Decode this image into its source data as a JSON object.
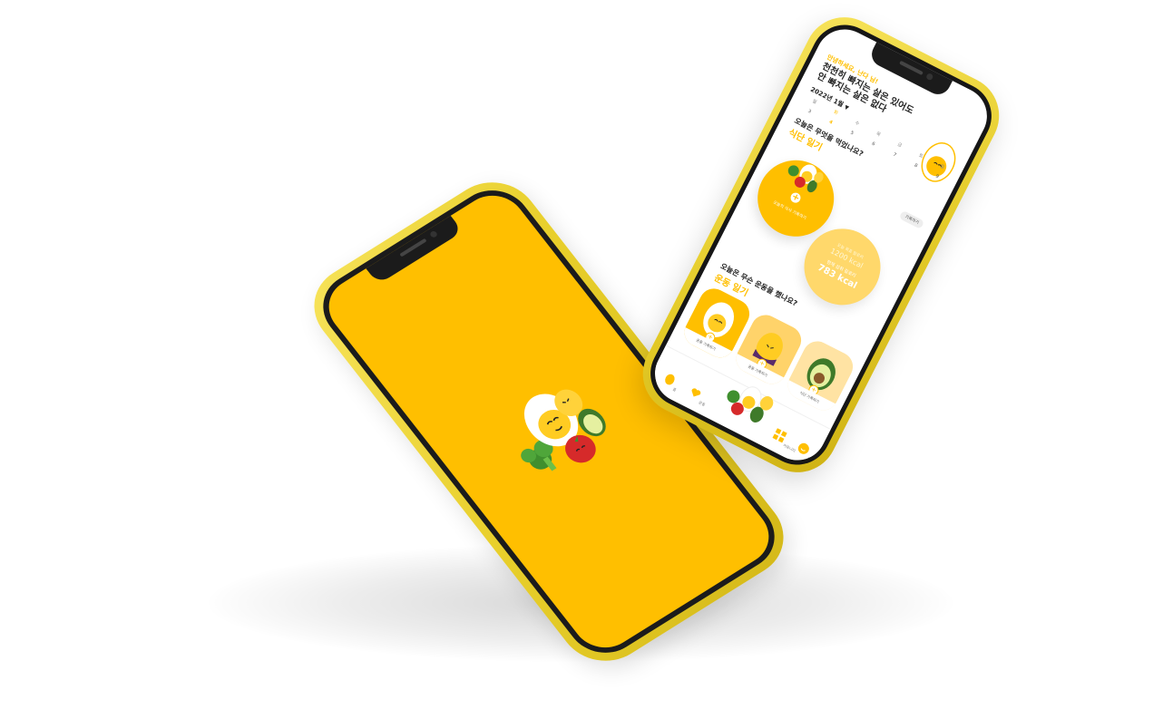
{
  "colors": {
    "accent": "#ffbf00",
    "frame": "#efd73a",
    "light": "#ffd86b"
  },
  "app": {
    "greeting": "안녕하세요, 난다 님!",
    "headline_1": "천천히 빠지는 살은 있어도",
    "headline_2": "안 빠지는 살은 없다",
    "month": "2022년 1월",
    "week": [
      {
        "w": "월",
        "n": "3"
      },
      {
        "w": "화",
        "n": "4"
      },
      {
        "w": "수",
        "n": "5"
      },
      {
        "w": "목",
        "n": "6"
      },
      {
        "w": "금",
        "n": "7"
      },
      {
        "w": "토",
        "n": "8"
      },
      {
        "w": "일",
        "n": "9"
      }
    ],
    "meal_question": "오늘은 무엇을 먹었나요?",
    "meal_title": "식단 일기",
    "record_button": "기록하기",
    "meal_circle_label": "오늘의 식사 기록하기",
    "target_label": "오늘 목표 칼로리",
    "target_value": "1200 kcal",
    "current_label": "현재 섭취 칼로리",
    "current_value": "783 kcal",
    "exercise_question": "오늘은 무슨 운동을 했나요?",
    "exercise_title": "운동 일기",
    "cards": [
      {
        "label": "운동 기록하기"
      },
      {
        "label": "운동 기록하기"
      },
      {
        "label": "식단 기록하기"
      }
    ],
    "tabs": [
      {
        "label": "홈"
      },
      {
        "label": "운동"
      },
      {
        "label": "커뮤니티"
      },
      {
        "label": "MY"
      }
    ]
  }
}
